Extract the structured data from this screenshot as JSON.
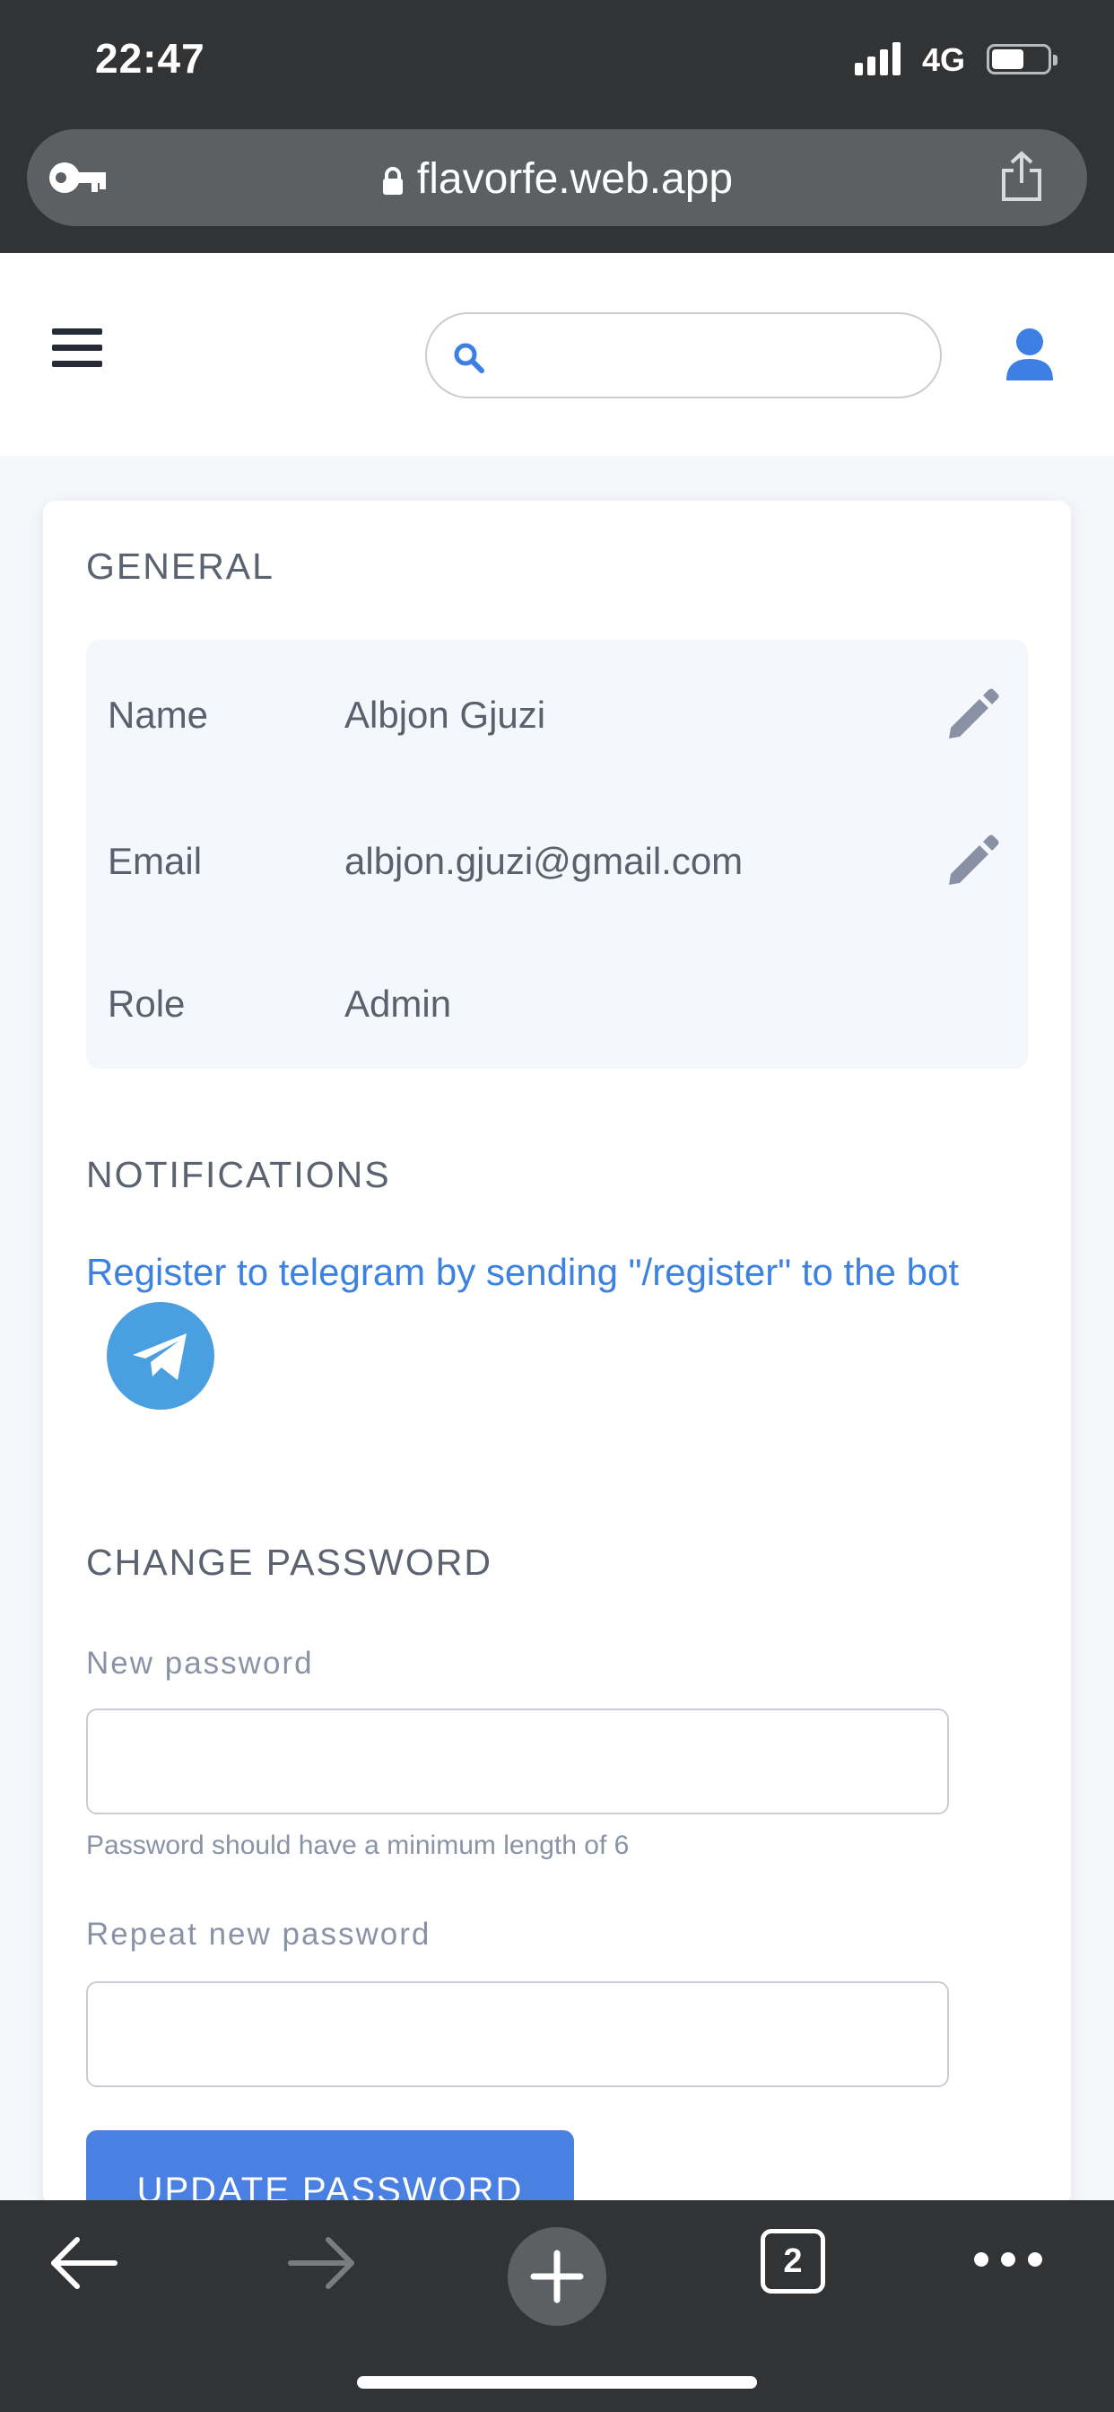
{
  "status_bar": {
    "time": "22:47",
    "network": "4G"
  },
  "browser": {
    "url": "flavorfe.web.app",
    "tab_count": "2"
  },
  "header": {
    "search_placeholder": ""
  },
  "general": {
    "title": "GENERAL",
    "rows": [
      {
        "label": "Name",
        "value": "Albjon Gjuzi",
        "editable": true
      },
      {
        "label": "Email",
        "value": "albjon.gjuzi@gmail.com",
        "editable": true
      },
      {
        "label": "Role",
        "value": "Admin",
        "editable": false
      }
    ]
  },
  "notifications": {
    "title": "NOTIFICATIONS",
    "telegram_text": "Register to telegram by sending \"/register\" to the bot"
  },
  "change_password": {
    "title": "CHANGE PASSWORD",
    "new_label": "New password",
    "new_value": "",
    "helper": "Password should have a minimum length of 6",
    "repeat_label": "Repeat new password",
    "repeat_value": "",
    "button_label": "UPDATE PASSWORD"
  },
  "colors": {
    "accent": "#4a80e2",
    "link": "#3d82e0",
    "telegram": "#4a9fe0",
    "chrome_bg": "#323335"
  }
}
